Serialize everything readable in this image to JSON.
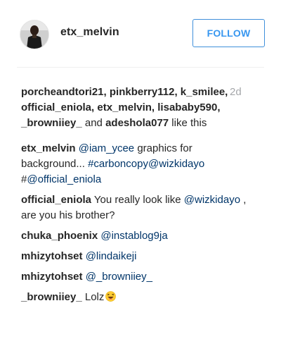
{
  "header": {
    "username": "etx_melvin",
    "follow_label": "FOLLOW"
  },
  "likes": {
    "users": [
      "porcheandtori21",
      "pinkberry112",
      "k_smilee",
      "official_eniola",
      "etx_melvin",
      "lisababy590",
      "_browniiey_",
      "adeshola077"
    ],
    "and_word": "and",
    "suffix": "like this"
  },
  "timestamp": "2d",
  "comments": [
    {
      "user": "etx_melvin",
      "parts": [
        {
          "type": "mention",
          "text": "@iam_ycee"
        },
        {
          "type": "text",
          "text": " graphics for background... "
        },
        {
          "type": "hashtag",
          "text": "#carboncopy"
        },
        {
          "type": "mention",
          "text": "@wizkidayo"
        },
        {
          "type": "text",
          "text": " #"
        },
        {
          "type": "mention",
          "text": "@official_eniola"
        }
      ]
    },
    {
      "user": "official_eniola",
      "parts": [
        {
          "type": "text",
          "text": " You really look like "
        },
        {
          "type": "mention",
          "text": "@wizkidayo"
        },
        {
          "type": "text",
          "text": " , are you his brother?"
        }
      ]
    },
    {
      "user": "chuka_phoenix",
      "parts": [
        {
          "type": "mention",
          "text": "@instablog9ja"
        }
      ]
    },
    {
      "user": "mhizytohset",
      "parts": [
        {
          "type": "mention",
          "text": "@lindaikeji"
        }
      ]
    },
    {
      "user": "mhizytohset",
      "parts": [
        {
          "type": "mention",
          "text": "@_browniiey_"
        }
      ]
    },
    {
      "user": "_browniiey_",
      "parts": [
        {
          "type": "text",
          "text": " Lolz"
        }
      ],
      "emoji": "laughing-emoji"
    }
  ]
}
